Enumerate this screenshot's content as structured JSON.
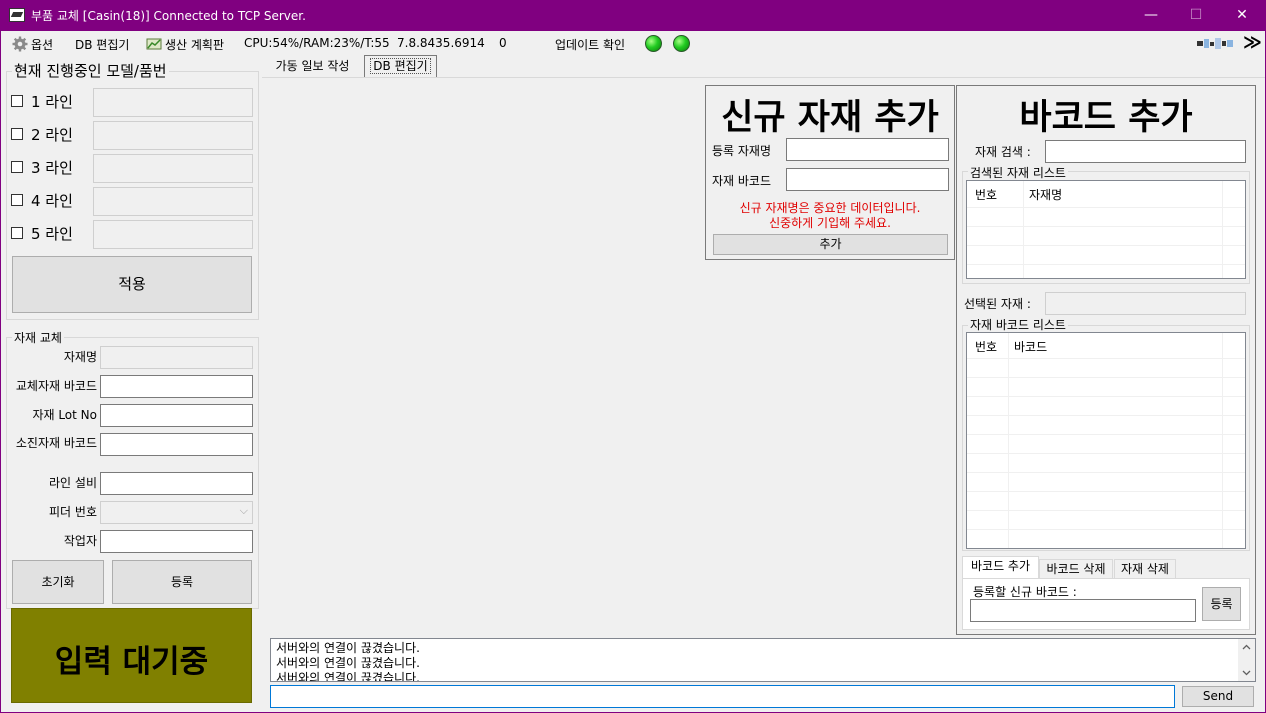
{
  "window": {
    "title": "부품 교체 [Casin(18)] Connected to TCP Server.",
    "minimize": "—",
    "maximize": "☐",
    "close": "✕"
  },
  "menu": {
    "options": "옵션",
    "db_editor": "DB 편집기",
    "production_plan": "생산 계획판",
    "stats": "CPU:54%/RAM:23%/T:55",
    "version": "7.8.8435.6914",
    "counter": "0",
    "update_check": "업데이트 확인",
    "overflow": "≫"
  },
  "model_group": {
    "title": "현재 진행중인 모델/품번",
    "lines": [
      "1 라인",
      "2 라인",
      "3 라인",
      "4 라인",
      "5 라인"
    ],
    "apply_label": "적용"
  },
  "swap_group": {
    "title": "자재 교체",
    "fields": {
      "material_name": "자재명",
      "swap_barcode": "교체자재 바코드",
      "lot_no": "자재 Lot No",
      "used_barcode": "소진자재 바코드",
      "line_equipment": "라인 설비",
      "feeder_no": "피더 번호",
      "worker": "작업자"
    },
    "reset_label": "초기화",
    "register_label": "등록"
  },
  "status_banner": {
    "text": "입력 대기중",
    "color": "#808000"
  },
  "tabs": [
    "가동 일보 작성",
    "DB 편집기"
  ],
  "new_material": {
    "title": "신규 자재 추가",
    "name_label": "등록 자재명",
    "barcode_label": "자재 바코드",
    "warning_line1": "신규 자재명은 중요한 데이터입니다.",
    "warning_line2": "신중하게 기입해 주세요.",
    "add_label": "추가",
    "warning_color": "#e00000"
  },
  "barcode_add": {
    "title": "바코드 추가",
    "search_label": "자재 검색 :",
    "found_list_title": "검색된 자재 리스트",
    "found_columns": [
      "번호",
      "자재명"
    ],
    "selected_label": "선택된 자재 :",
    "barcode_list_title": "자재 바코드 리스트",
    "barcode_columns": [
      "번호",
      "바코드"
    ],
    "tabs": [
      "바코드 추가",
      "바코드 삭제",
      "자재 삭제"
    ],
    "new_barcode_label": "등록할 신규 바코드 :",
    "register_label": "등록"
  },
  "log": {
    "lines": [
      "서버와의 연결이 끊겼습니다.",
      "서버와의 연결이 끊겼습니다.",
      "서버와의 연결이 끊겼습니다."
    ],
    "send_label": "Send"
  }
}
